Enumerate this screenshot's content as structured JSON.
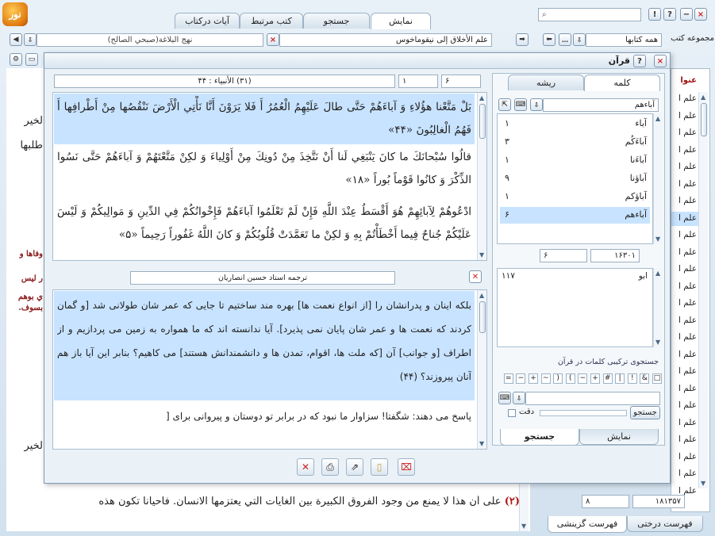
{
  "app": {
    "logo_text": "نور"
  },
  "tabs": [
    {
      "label": "نمایش",
      "active": true
    },
    {
      "label": "جستجو",
      "active": false
    },
    {
      "label": "کتب مرتبط",
      "active": false
    },
    {
      "label": "آیات درکتاب",
      "active": false
    }
  ],
  "window_controls": {
    "close": "×",
    "help": "?",
    "info": "!",
    "minimize": "−"
  },
  "toolbar": {
    "book_title": "علم الأخلاق إلی نیقوماخوس",
    "other_book": "نهج البلاغة(صبحي الصالح)",
    "group_label": "مجموعه کتب",
    "group_select": "همه کتابها"
  },
  "sidebar": {
    "heading": "عنوا",
    "items": [
      "علم ا",
      "علم ا",
      "علم ا",
      "علم ا",
      "علم ا",
      "علم ا",
      "علم ا",
      "علم ا",
      "علم ا",
      "علم ا",
      "علم ا",
      "علم ا",
      "علم ا",
      "علم ا",
      "علم ا",
      "علم ا",
      "علم ا",
      "علم ا",
      "علم ا",
      "علم ا",
      "علم ا",
      "علم ا",
      "علم ا",
      "علم ا"
    ],
    "footer_num_left": "۸",
    "footer_num_right": "۱۸۱۳۵۷",
    "tab_tree": "فهرست درختی",
    "tab_select": "فهرست گزینشی"
  },
  "background_doc": {
    "left_snippets": [
      "لخير",
      "طلبها",
      "وفاها و",
      "ر لیس",
      "ي بوهم",
      "بسوف.",
      "لخير"
    ],
    "bottom_line": "على أن هذا لا يمنع من وجود الفروق الكبيرة بين الغايات التي يعتزمها الانسان. فأحيانا تكون هذه",
    "bottom_mark": "(۲)"
  },
  "quran_window": {
    "title": "قرآن",
    "verse_ref": "(۳۱) الأنبياء : ۴۴",
    "field_a": "۶",
    "field_b": "۱",
    "verses": [
      "بَلْ مَتَّعْنا هؤُلاءِ وَ آباءَهُمْ حَتَّى طالَ عَلَيْهِمُ الْعُمُرُ أَ فَلا يَرَوْنَ أَنَّا نَأْتِي الْأَرْضَ نَنْقُصُها مِنْ أَطْرافِها أَ فَهُمُ الْغالِبُونَ «۴۴»",
      "قالُوا سُبْحانَكَ ما كانَ يَنْبَغِي لَنا أَنْ نَتَّخِذَ مِنْ دُونِكَ مِنْ أَوْلِياءَ وَ لكِنْ مَتَّعْتَهُمْ وَ آباءَهُمْ حَتَّى نَسُوا الذِّكْرَ وَ كانُوا قَوْماً بُوراً «۱۸»",
      "ادْعُوهُمْ لِآبائِهِمْ هُوَ أَقْسَطُ عِنْدَ اللَّهِ فَإِنْ لَمْ تَعْلَمُوا آباءَهُمْ فَإِخْوانُكُمْ فِي الدِّينِ وَ مَوالِيكُمْ وَ لَيْسَ عَلَيْكُمْ جُناحٌ فِيما أَخْطَأْتُمْ بِهِ وَ لكِنْ ما تَعَمَّدَتْ قُلُوبُكُمْ وَ كانَ اللَّهُ غَفُوراً رَحِيماً «۵»"
    ],
    "translation_title": "ترجمه استاد حسین انصاریان",
    "translation": [
      "بلكه اينان و پدرانشان را [از انواع نعمت ها] بهره مند ساختيم تا جايى كه عمر شان طولانى شد [و گمان كردند كه نعمت ها و عمر شان پايان نمى پذيرد]. آيا ندانسته اند كه ما همواره به زمين مى پردازيم و از اطراف [و جوانب] آن [كه ملت ها، اقوام، تمدن ها و دانشمندانش هستند] مى كاهيم؟ بنابر اين آيا باز هم آنان پيروزند؟ (۴۴)",
      "پاسخ مى دهند: شگفتا! سزاوار ما نبود كه در برابر تو دوستان و پيروانى براى ["
    ],
    "right_tabs": {
      "word": "کلمه",
      "root": "ریشه"
    },
    "search_word": "آباءهم",
    "words": [
      {
        "w": "آباء",
        "c": "۱"
      },
      {
        "w": "آباءَكُم",
        "c": "۳"
      },
      {
        "w": "آباءَنا",
        "c": "۱"
      },
      {
        "w": "آباؤنا",
        "c": "۹"
      },
      {
        "w": "آباؤكم",
        "c": "۱"
      },
      {
        "w": "آباءهم",
        "c": "۶"
      }
    ],
    "stat_left": "۶",
    "stat_right": "۱۶۳۰۱",
    "result_word": "ابو",
    "result_count": "۱۱۷",
    "combo_title": "جستجوی ترکیبی کلمات در قرآن",
    "ops": [
      "□",
      "&",
      "!",
      "|",
      "#",
      "+",
      "−",
      "(",
      ")",
      "~",
      "+",
      "−",
      "="
    ],
    "search_btn": "جستجو",
    "exact_label": "دقت",
    "bottom_tabs": {
      "show": "نمایش",
      "search": "جستجو"
    }
  },
  "colors": {
    "highlight": "#c8e3ff",
    "accent": "#2a5d8a",
    "close_red": "#d03020"
  }
}
